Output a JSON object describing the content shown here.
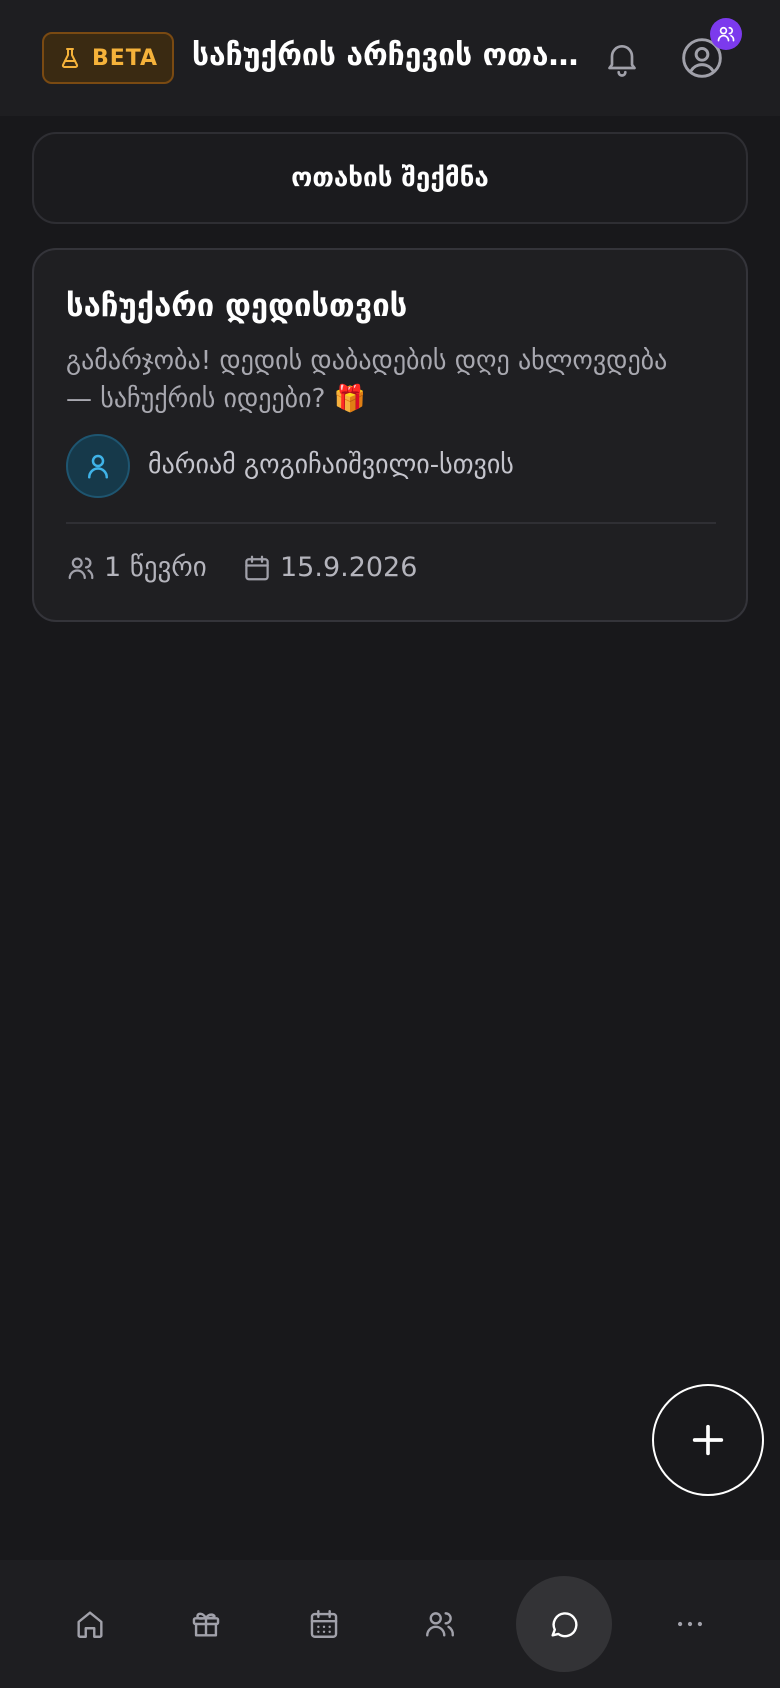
{
  "header": {
    "beta_label": "BETA",
    "title": "საჩუქრის არჩევის ოთახები",
    "notifications_icon": "bell-icon",
    "account_icon": "user-circle-icon",
    "badge_icon": "users-icon"
  },
  "actions": {
    "create_room_label": "ოთახის შექმნა"
  },
  "rooms": [
    {
      "title": "საჩუქარი დედისთვის",
      "description": "გამარჯობა! დედის დაბადების დღე ახლოვდება — საჩუქრის იდეები? 🎁",
      "recipient": "მარიამ გოგიჩაიშვილი-სთვის",
      "members": "1 წევრი",
      "date": "15.9.2026"
    }
  ],
  "bottom_nav": {
    "items": [
      "home-icon",
      "gift-icon",
      "calendar-icon",
      "users-icon",
      "chat-icon",
      "more-icon"
    ],
    "active": "chat-icon"
  },
  "colors": {
    "background": "#18181b",
    "accent_beta": "#f5b23a",
    "badge": "#7c3aed",
    "recipient_icon": "#3fb3e8"
  }
}
